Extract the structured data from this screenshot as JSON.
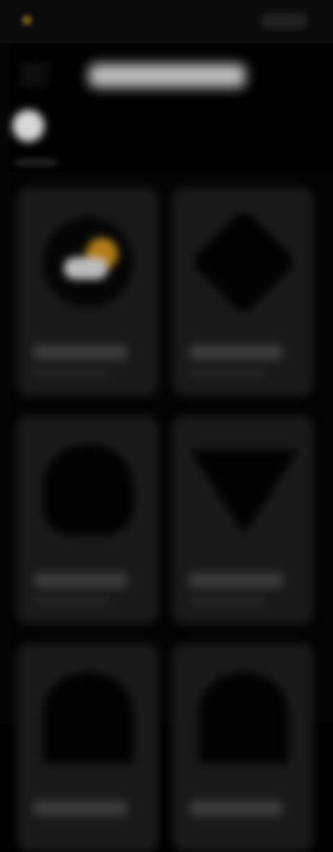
{
  "header": {
    "brand_text": "",
    "action_label": ""
  },
  "page": {
    "title": ""
  },
  "profile": {
    "label": ""
  },
  "cards": [
    {
      "label": "",
      "icon": "weather-icon"
    },
    {
      "label": "",
      "icon": "diamond-icon"
    },
    {
      "label": "",
      "icon": "shield-icon"
    },
    {
      "label": "",
      "icon": "triangle-icon"
    },
    {
      "label": "",
      "icon": "app-icon"
    },
    {
      "label": "",
      "icon": "app-icon"
    }
  ],
  "colors": {
    "background": "#000000",
    "card": "#191919",
    "accent": "#b27d16",
    "title": "#c9c9c9"
  }
}
